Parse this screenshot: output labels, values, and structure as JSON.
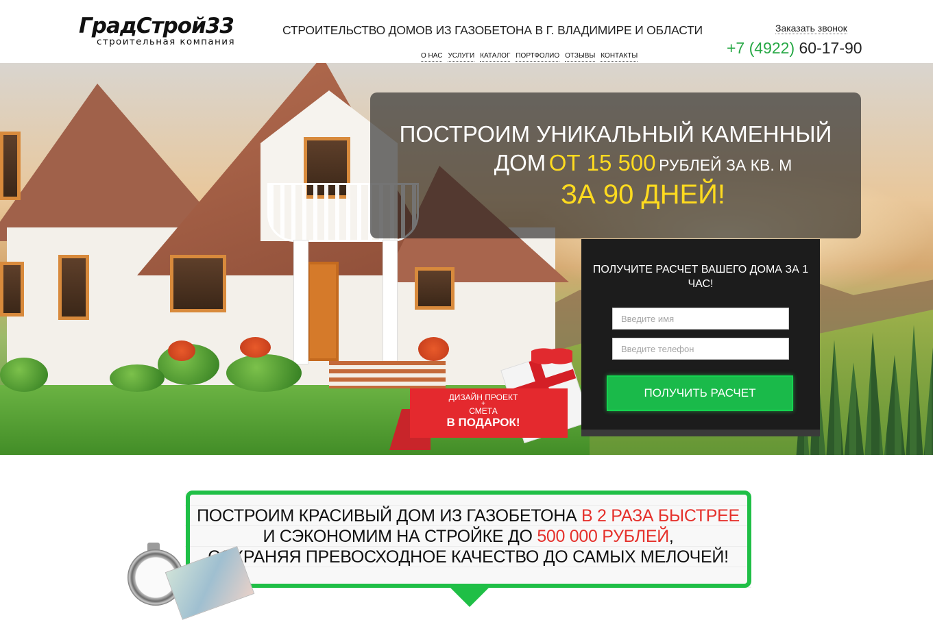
{
  "header": {
    "logo_name": "ГрадСтрой33",
    "logo_sub": "строительная компания",
    "tagline": "СТРОИТЕЛЬСТВО ДОМОВ ИЗ ГАЗОБЕТОНА В Г. ВЛАДИМИРЕ И ОБЛАСТИ",
    "nav": [
      "О НАС",
      "УСЛУГИ",
      "КАТАЛОГ",
      "ПОРТФОЛИО",
      "ОТЗЫВЫ",
      "КОНТАКТЫ"
    ],
    "callback_label": "Заказать звонок",
    "phone_code": "+7 (4922)",
    "phone_number": "60-17-90"
  },
  "hero": {
    "line1": "ПОСТРОИМ УНИКАЛЬНЫЙ КАМЕННЫЙ",
    "line2_a": "ДОМ",
    "line2_price": "ОТ 15 500",
    "line2_unit": "РУБЛЕЙ ЗА КВ. М",
    "line3": "ЗА 90 ДНЕЙ!"
  },
  "form": {
    "title": "ПОЛУЧИТЕ РАСЧЕТ ВАШЕГО ДОМА ЗА 1 ЧАС!",
    "name_placeholder": "Введите имя",
    "phone_placeholder": "Введите телефон",
    "submit_label": "ПОЛУЧИТЬ РАСЧЕТ"
  },
  "gift": {
    "line1": "ДИЗАЙН ПРОЕКТ",
    "line2": "+",
    "line3": "СМЕТА",
    "line4": "В ПОДАРОК!"
  },
  "section2": {
    "l1_a": "ПОСТРОИМ КРАСИВЫЙ ДОМ ИЗ ГАЗОБЕТОНА",
    "l1_red": "В 2 РАЗА БЫСТРЕЕ",
    "l2_a": "И СЭКОНОМИМ НА СТРОЙКЕ ДО",
    "l2_red": "500 000 РУБЛЕЙ",
    "l2_b": ",",
    "l3": "СОХРАНЯЯ ПРЕВОСХОДНОЕ КАЧЕСТВО  ДО САМЫХ МЕЛОЧЕЙ!"
  },
  "colors": {
    "accent_green": "#1fbf46",
    "highlight_yellow": "#ffdb1f",
    "highlight_red": "#e5312c",
    "phone_green": "#27a845"
  },
  "icons": [
    "gift-box-icon",
    "stopwatch-icon",
    "money-icon"
  ]
}
